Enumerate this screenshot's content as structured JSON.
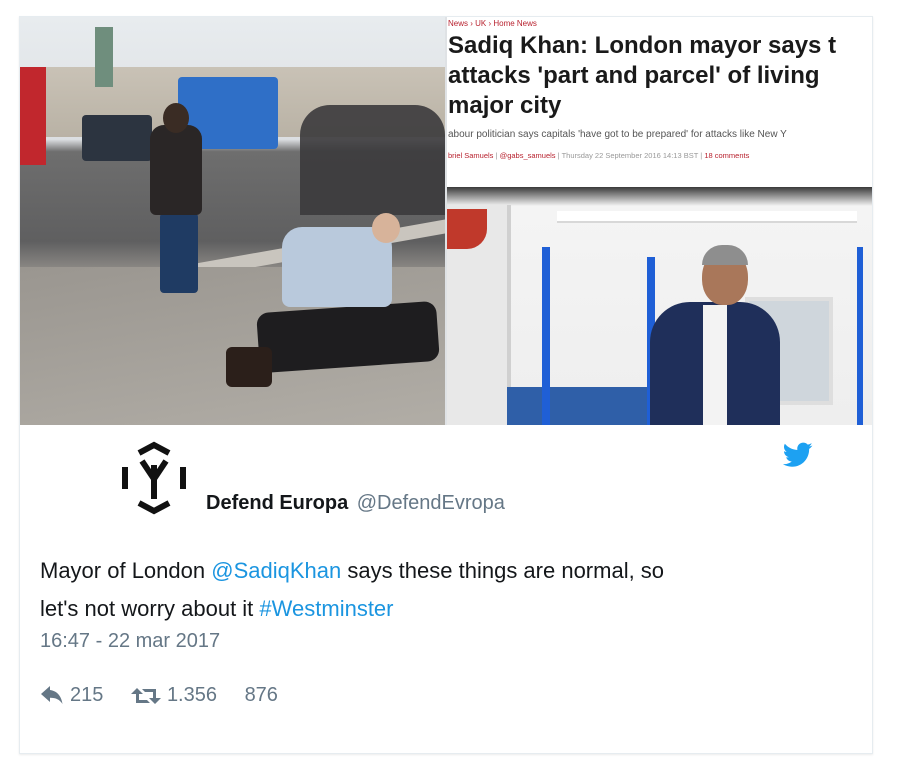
{
  "article": {
    "breadcrumb": "News › UK › Home News",
    "headline_lines": [
      "Sadiq Khan: London mayor says t",
      "attacks 'part and parcel' of living",
      "major city"
    ],
    "standfirst": "abour politician says capitals 'have got to be prepared' for attacks like New Y",
    "byline_author": "briel Samuels",
    "byline_handle": "@gabs_samuels",
    "byline_date": "Thursday 22 September 2016 14:13 BST",
    "byline_comments": "18 comments"
  },
  "tweet": {
    "display_name": "Defend Europa",
    "handle": "@DefendEvropa",
    "text_1": "Mayor of London ",
    "mention": "@SadiqKhan",
    "text_2": " says these things are normal, so",
    "text_3": "let's not worry about it ",
    "hashtag": "#Westminster",
    "timestamp": "16:47 - 22 mar 2017",
    "replies": "215",
    "retweets": "1.356",
    "likes": "876"
  },
  "colors": {
    "link": "#1b95e0",
    "twitter_blue": "#1da1f2",
    "muted": "#657786"
  },
  "icons": [
    "defend-europa-logo-icon",
    "twitter-bird-icon",
    "reply-icon",
    "retweet-icon"
  ]
}
